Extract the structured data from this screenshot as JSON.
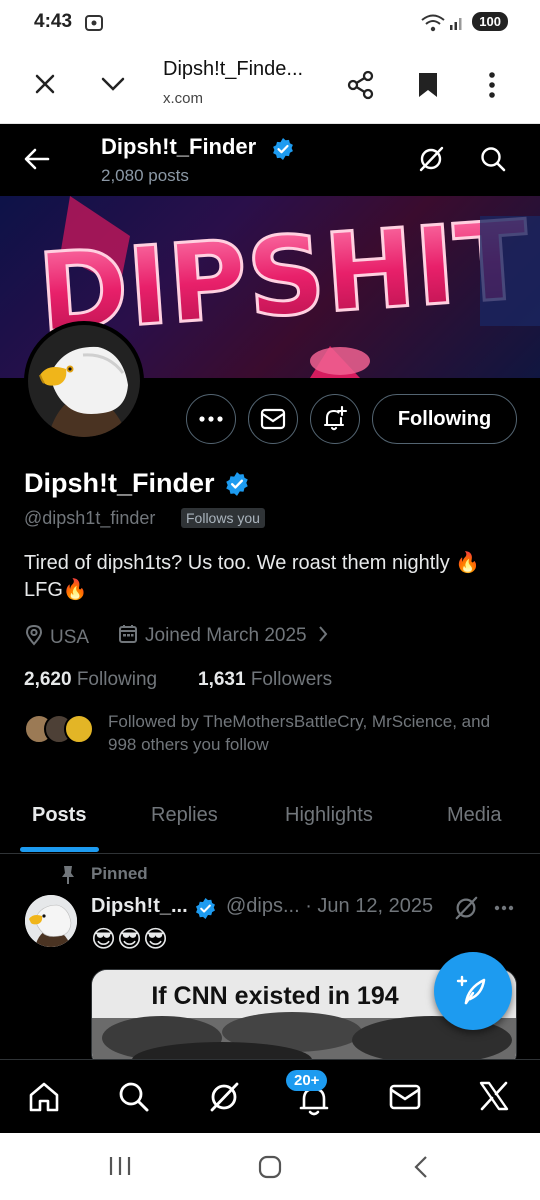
{
  "status_bar": {
    "time": "4:43",
    "battery": "100"
  },
  "browser": {
    "page_title": "Dipsh!t_Finde...",
    "url": "x.com"
  },
  "profile_header": {
    "name": "Dipsh!t_Finder",
    "post_count": "2,080 posts"
  },
  "banner": {
    "text": "DIPSHIT"
  },
  "actions": {
    "follow_state": "Following"
  },
  "profile": {
    "display_name": "Dipsh!t_Finder",
    "handle": "@dipsh1t_finder",
    "follows_you": "Follows you",
    "bio_line1": "Tired of dipsh1ts? Us too. We roast them nightly 🔥",
    "bio_line2": "LFG🔥",
    "location": "USA",
    "joined": "Joined March 2025",
    "following_count": "2,620",
    "following_label": "Following",
    "followers_count": "1,631",
    "followers_label": "Followers",
    "followed_by": "Followed by TheMothersBattleCry, MrScience, and 998 others you follow"
  },
  "tabs": [
    {
      "label": "Posts"
    },
    {
      "label": "Replies"
    },
    {
      "label": "Highlights"
    },
    {
      "label": "Media"
    }
  ],
  "pinned_post": {
    "pinned_label": "Pinned",
    "author": "Dipsh!t_...",
    "handle_date": "@dips... · Jun 12, 2025",
    "content": "😎😎😎",
    "media_caption": "If CNN existed in 194"
  },
  "bottom_nav": {
    "notifications_badge": "20+"
  },
  "colors": {
    "accent": "#1d9bf0",
    "background": "#000000",
    "muted": "#71767b"
  }
}
